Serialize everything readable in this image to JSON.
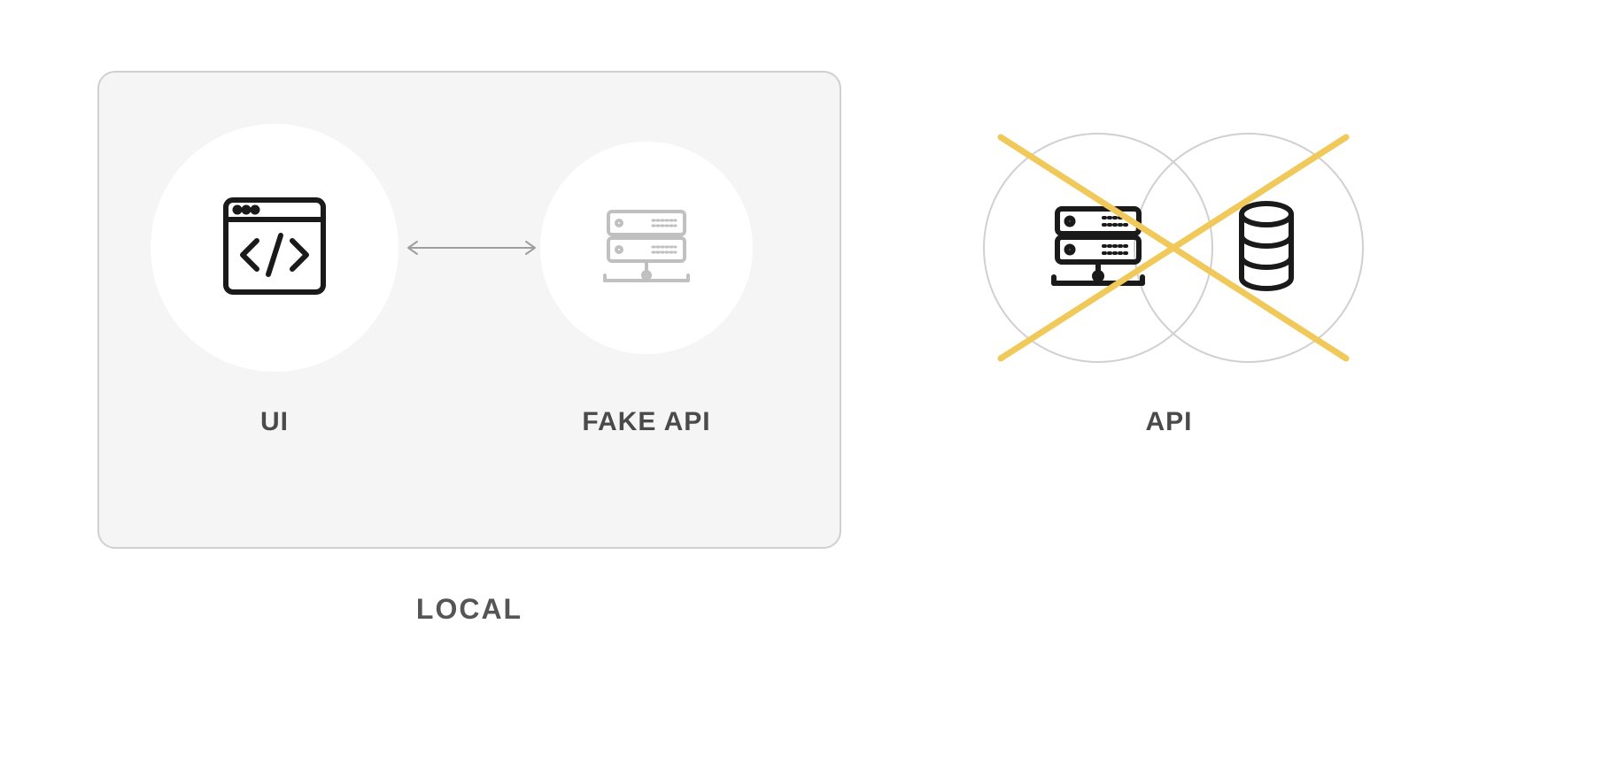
{
  "diagram": {
    "local_box_label": "LOCAL",
    "nodes": {
      "ui": {
        "label": "UI",
        "icon": "code-window-icon"
      },
      "fake_api": {
        "label": "FAKE API",
        "icon": "server-icon-light"
      },
      "api": {
        "label": "API",
        "icon_server": "server-icon",
        "icon_db": "database-icon",
        "crossed_out": true
      }
    },
    "arrows": [
      {
        "from": "ui",
        "to": "fake_api",
        "style": "bidirectional"
      }
    ],
    "colors": {
      "box_border": "#d0d0d0",
      "box_bg": "#f5f5f5",
      "text": "#4a4a4a",
      "cross": "#f0c95a",
      "icon_dark": "#1a1a1a",
      "icon_light": "#c0c0c0",
      "arrow": "#9e9e9e"
    }
  }
}
